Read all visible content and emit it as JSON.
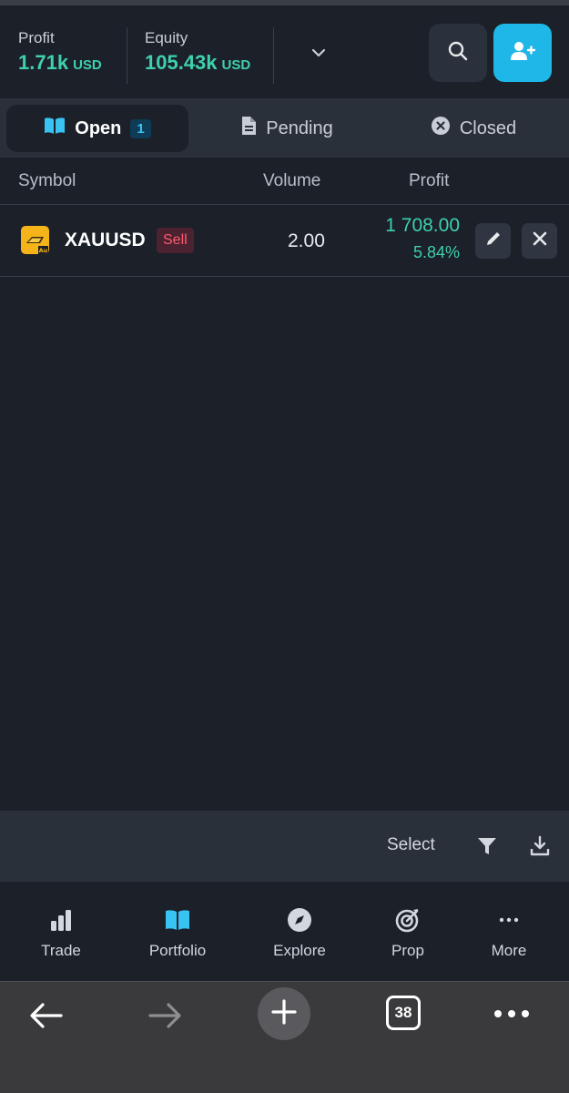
{
  "header": {
    "profit_label": "Profit",
    "profit_value": "1.71k",
    "profit_currency": "USD",
    "equity_label": "Equity",
    "equity_value": "105.43k",
    "equity_currency": "USD"
  },
  "tabs": [
    {
      "label": "Open",
      "count": "1",
      "active": true
    },
    {
      "label": "Pending"
    },
    {
      "label": "Closed"
    }
  ],
  "table": {
    "headers": {
      "symbol": "Symbol",
      "volume": "Volume",
      "profit": "Profit"
    },
    "rows": [
      {
        "symbol": "XAUUSD",
        "icon_text": "Au",
        "side": "Sell",
        "volume": "2.00",
        "profit": "1 708.00",
        "profit_pct": "5.84%"
      }
    ]
  },
  "footer": {
    "select_label": "Select"
  },
  "bottom_nav": [
    {
      "label": "Trade",
      "icon": "bar-chart-icon"
    },
    {
      "label": "Portfolio",
      "icon": "book-icon",
      "active": true
    },
    {
      "label": "Explore",
      "icon": "compass-icon"
    },
    {
      "label": "Prop",
      "icon": "target-icon"
    },
    {
      "label": "More",
      "icon": "more-icon"
    }
  ],
  "browser": {
    "tab_count": "38"
  },
  "colors": {
    "accent": "#1fb6e8",
    "positive": "#3fd0ae",
    "negative": "#ff5a6e",
    "background": "#1b2029",
    "surface": "#2a303a"
  }
}
